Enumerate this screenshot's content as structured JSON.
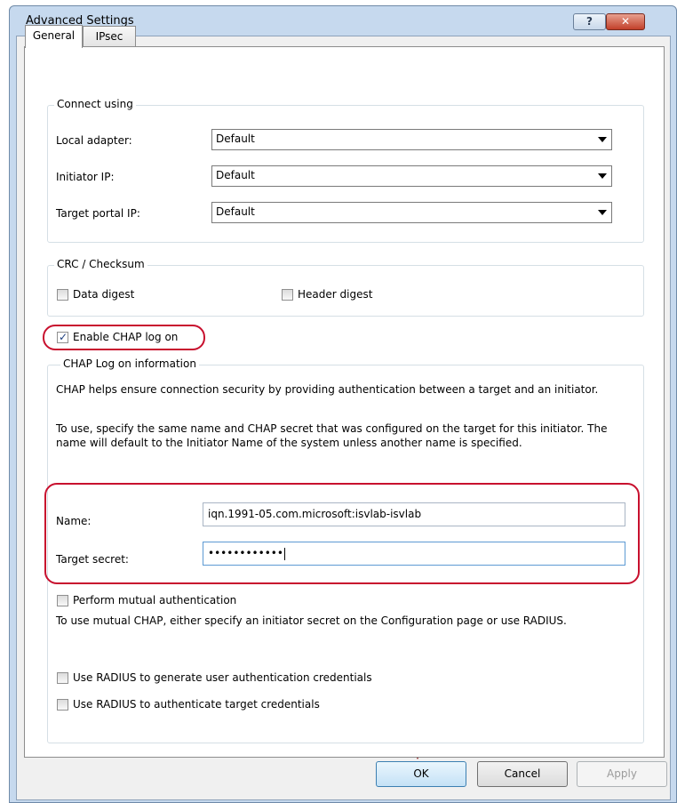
{
  "window": {
    "title": "Advanced Settings",
    "help_label": "?",
    "close_label": "✕"
  },
  "tabs": [
    {
      "label": "General"
    },
    {
      "label": "IPsec"
    }
  ],
  "connect": {
    "title": "Connect using",
    "local_adapter": {
      "label": "Local adapter:",
      "value": "Default"
    },
    "initiator_ip": {
      "label": "Initiator IP:",
      "value": "Default"
    },
    "target_portal_ip": {
      "label": "Target portal IP:",
      "value": "Default"
    }
  },
  "crc": {
    "title": "CRC / Checksum",
    "data_digest": "Data digest",
    "header_digest": "Header digest"
  },
  "chap": {
    "enable_label": "Enable CHAP log on",
    "enable_checked": true,
    "group_title": "CHAP Log on information",
    "desc1": "CHAP helps ensure connection security by providing authentication between a target and an initiator.",
    "desc2": "To use, specify the same name and CHAP secret that was configured on the target for this initiator.  The name will default to the Initiator Name of the system unless another name is specified.",
    "name_label": "Name:",
    "name_value": "iqn.1991-05.com.microsoft:isvlab-isvlab",
    "secret_label": "Target secret:",
    "secret_value": "••••••••••••",
    "mutual_label": "Perform mutual authentication",
    "mutual_desc": "To use mutual CHAP, either specify an initiator secret on the Configuration page or use RADIUS.",
    "radius_gen_label": "Use RADIUS to generate user authentication credentials",
    "radius_auth_label": "Use RADIUS to authenticate target credentials"
  },
  "buttons": {
    "ok": "OK",
    "cancel": "Cancel",
    "apply": "Apply"
  },
  "colors": {
    "highlight": "#c8102e",
    "arrow": "#8b1a1a"
  }
}
